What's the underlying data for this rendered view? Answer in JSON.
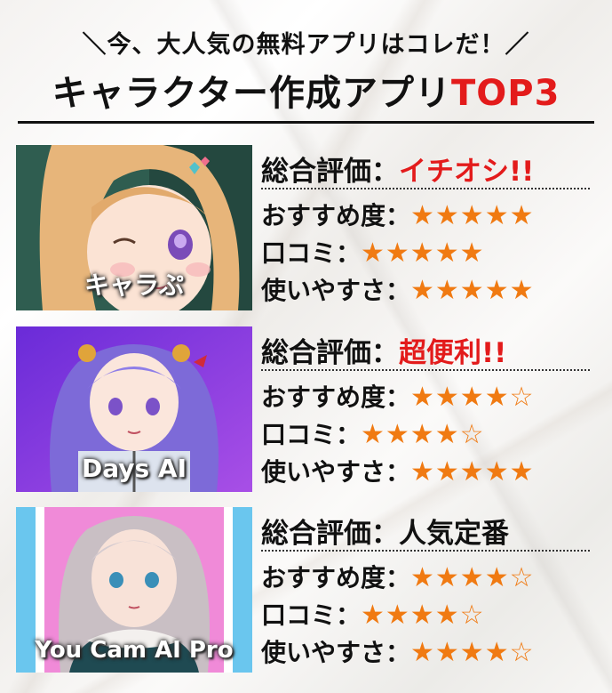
{
  "header": {
    "subtitle": "＼今、大人気の無料アプリはコレだ！／",
    "title_main": "キャラクター作成アプリ",
    "title_accent": "TOP3"
  },
  "colors": {
    "accent": "#e31b1b",
    "star": "#f07a12",
    "text": "#111111"
  },
  "apps": [
    {
      "name": "キャラぷ",
      "overall_label": "総合評価：",
      "overall_value": "イチオシ!!",
      "ratings": [
        {
          "label": "おすすめ度：",
          "stars": "★★★★★",
          "score": 5
        },
        {
          "label": "口コミ：",
          "stars": "★★★★★",
          "score": 5
        },
        {
          "label": "使いやすさ：",
          "stars": "★★★★★",
          "score": 5
        }
      ]
    },
    {
      "name": "Days AI",
      "overall_label": "総合評価：",
      "overall_value": "超便利!!",
      "ratings": [
        {
          "label": "おすすめ度：",
          "stars": "★★★★☆",
          "score": 4
        },
        {
          "label": "口コミ：",
          "stars": "★★★★☆",
          "score": 4
        },
        {
          "label": "使いやすさ：",
          "stars": "★★★★★",
          "score": 5
        }
      ]
    },
    {
      "name": "You Cam AI Pro",
      "overall_label": "総合評価：",
      "overall_value": "人気定番",
      "ratings": [
        {
          "label": "おすすめ度：",
          "stars": "★★★★☆",
          "score": 4
        },
        {
          "label": "口コミ：",
          "stars": "★★★★☆",
          "score": 4
        },
        {
          "label": "使いやすさ：",
          "stars": "★★★★☆",
          "score": 4
        }
      ]
    }
  ]
}
